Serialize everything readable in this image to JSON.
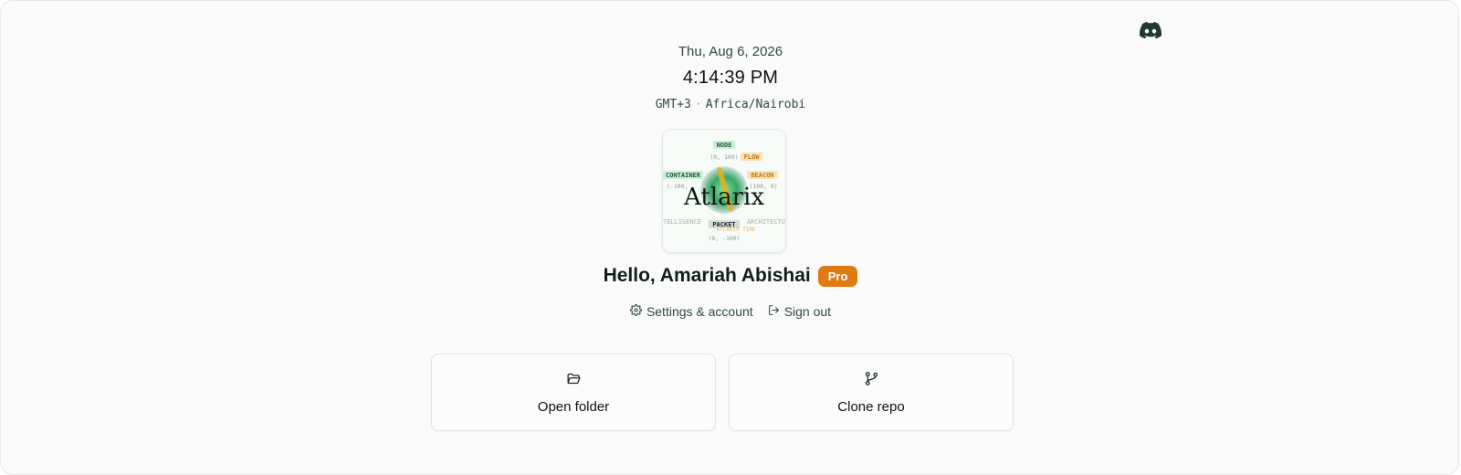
{
  "header": {
    "discord_icon": "discord-icon"
  },
  "clock": {
    "date": "Thu, Aug 6, 2026",
    "time": "4:14:39 PM",
    "offset": "GMT+3",
    "separator": "·",
    "zone": "Africa/Nairobi"
  },
  "logo": {
    "wordmark": "Atlarix",
    "labels": {
      "node": "NODE",
      "node_coord": "(0, 100)",
      "flow": "FLOW",
      "container": "CONTAINER",
      "container_coord": "(-100,",
      "beacon": "BEACON",
      "beacon_coord": "(100, 0)",
      "packet": "PACKET",
      "packet_coord": "(0, -100)",
      "intel": "TELLIGENCE",
      "arch": "ARCHITECTU",
      "tagline": "ATLARIX TIME"
    }
  },
  "user": {
    "greeting": "Hello, Amariah Abishai",
    "plan": "Pro"
  },
  "links": {
    "settings": "Settings & account",
    "signout": "Sign out"
  },
  "actions": {
    "open_folder": "Open folder",
    "clone_repo": "Clone repo"
  },
  "colors": {
    "accent": "#e07a12",
    "text_green": "#2f4a3a",
    "logo_green": "#2aa560"
  }
}
